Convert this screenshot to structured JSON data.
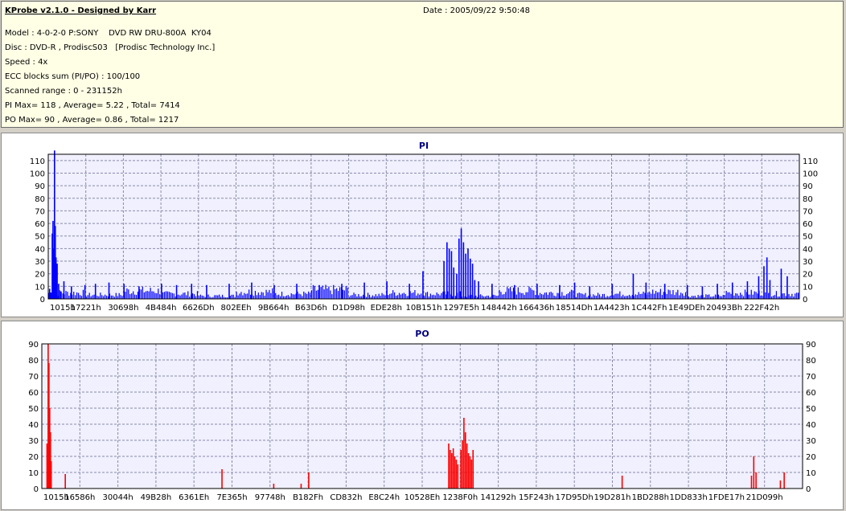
{
  "header": {
    "title": "KProbe v2.1.0 - Designed by Karr",
    "date": "Date : 2005/09/22 9:50:48",
    "model": "Model : 4-0-2-0 P:SONY    DVD RW DRU-800A  KY04",
    "disc": "Disc : DVD-R , ProdiscS03   [Prodisc Technology Inc.]",
    "speed": "Speed : 4x",
    "ecc": "ECC blocks sum (PI/PO) : 100/100",
    "range": "Scanned range : 0 - 231152h",
    "pi_stats": "PI Max= 118 , Average= 5.22 , Total= 7414",
    "po_stats": "PO Max= 90 , Average= 0.86 , Total= 1217"
  },
  "colors": {
    "background": "#d4d0c8",
    "header_bg": "#ffffe6",
    "plot_bg": "#f0f0ff",
    "pi_bar": "#0000ff",
    "po_bar": "#ff0000",
    "grid": "#8a8aa8",
    "title": "#000080"
  },
  "chart_data": [
    {
      "type": "bar",
      "title": "PI",
      "ylim": [
        0,
        115
      ],
      "yticks": [
        0,
        10,
        20,
        30,
        40,
        50,
        60,
        70,
        80,
        90,
        100,
        110
      ],
      "x_range": [
        "0h",
        "231152h"
      ],
      "x_ticklabels": [
        "1015h",
        "17221h",
        "30698h",
        "4B484h",
        "6626Dh",
        "802EEh",
        "9B664h",
        "B63D6h",
        "D1D98h",
        "EDE28h",
        "10B151h",
        "1297E5h",
        "148442h",
        "166436h",
        "18514Dh",
        "1A4423h",
        "1C442Fh",
        "1E49DEh",
        "20493Bh",
        "222F42h"
      ],
      "grid": true,
      "series": [
        {
          "baseline": [
            6,
            4,
            8,
            5,
            3,
            7,
            5,
            9,
            4,
            6,
            5,
            3,
            8,
            6,
            4,
            5,
            7,
            3,
            6,
            5
          ],
          "peaks": [
            [
              0.1,
              8
            ],
            [
              0.3,
              5
            ],
            [
              0.45,
              52
            ],
            [
              0.55,
              62
            ],
            [
              0.65,
              40
            ],
            [
              0.75,
              118
            ],
            [
              0.85,
              58
            ],
            [
              0.95,
              33
            ],
            [
              1.1,
              28
            ],
            [
              1.3,
              12
            ],
            [
              1.6,
              6
            ],
            [
              2.0,
              14
            ],
            [
              3.0,
              10
            ],
            [
              4.8,
              11
            ],
            [
              6.2,
              12
            ],
            [
              8.0,
              13
            ],
            [
              10.0,
              12
            ],
            [
              12.0,
              10
            ],
            [
              15.0,
              12
            ],
            [
              17.0,
              11
            ],
            [
              19.0,
              12
            ],
            [
              21.0,
              11
            ],
            [
              24.0,
              12
            ],
            [
              27.0,
              13
            ],
            [
              30.0,
              11
            ],
            [
              33.0,
              12
            ],
            [
              36.0,
              11
            ],
            [
              39.0,
              12
            ],
            [
              42.0,
              13
            ],
            [
              45.0,
              14
            ],
            [
              48.0,
              12
            ],
            [
              49.8,
              22
            ],
            [
              52.6,
              30
            ],
            [
              53.0,
              45
            ],
            [
              53.3,
              40
            ],
            [
              53.6,
              38
            ],
            [
              53.9,
              25
            ],
            [
              54.3,
              20
            ],
            [
              54.6,
              48
            ],
            [
              54.9,
              56
            ],
            [
              55.2,
              45
            ],
            [
              55.5,
              36
            ],
            [
              55.8,
              40
            ],
            [
              56.1,
              32
            ],
            [
              56.4,
              28
            ],
            [
              56.7,
              15
            ],
            [
              57.2,
              14
            ],
            [
              59.0,
              12
            ],
            [
              62.0,
              11
            ],
            [
              65.0,
              12
            ],
            [
              68.0,
              11
            ],
            [
              70.0,
              13
            ],
            [
              72.0,
              10
            ],
            [
              75.0,
              12
            ],
            [
              77.8,
              20
            ],
            [
              79.5,
              13
            ],
            [
              82.0,
              12
            ],
            [
              85.0,
              11
            ],
            [
              87.0,
              10
            ],
            [
              89.0,
              12
            ],
            [
              91.0,
              13
            ],
            [
              93.0,
              14
            ],
            [
              94.5,
              18
            ],
            [
              95.2,
              26
            ],
            [
              95.6,
              33
            ],
            [
              96.0,
              15
            ],
            [
              97.5,
              24
            ],
            [
              98.3,
              18
            ]
          ]
        }
      ]
    },
    {
      "type": "bar",
      "title": "PO",
      "ylim": [
        0,
        90
      ],
      "yticks": [
        0,
        10,
        20,
        30,
        40,
        50,
        60,
        70,
        80,
        90
      ],
      "x_range": [
        "0h",
        "231152h"
      ],
      "x_ticklabels": [
        "1015h",
        "16586h",
        "30044h",
        "49B28h",
        "6361Eh",
        "7E365h",
        "97748h",
        "B182Fh",
        "CD832h",
        "E8C24h",
        "10528Eh",
        "1238F0h",
        "141292h",
        "15F243h",
        "17D95Dh",
        "19D281h",
        "1BD288h",
        "1DD833h",
        "1FDE17h",
        "21D099h"
      ],
      "grid": true,
      "series": [
        {
          "baseline": [],
          "peaks": [
            [
              0.6,
              28
            ],
            [
              0.75,
              90
            ],
            [
              0.85,
              78
            ],
            [
              0.95,
              50
            ],
            [
              1.05,
              35
            ],
            [
              1.15,
              17
            ],
            [
              3.0,
              9
            ],
            [
              23.6,
              12
            ],
            [
              30.4,
              3
            ],
            [
              34.0,
              3
            ],
            [
              35.0,
              10
            ],
            [
              53.4,
              28
            ],
            [
              53.6,
              24
            ],
            [
              53.8,
              22
            ],
            [
              54.0,
              25
            ],
            [
              54.2,
              20
            ],
            [
              54.4,
              18
            ],
            [
              54.6,
              15
            ],
            [
              55.0,
              24
            ],
            [
              55.2,
              30
            ],
            [
              55.4,
              44
            ],
            [
              55.6,
              35
            ],
            [
              55.8,
              28
            ],
            [
              56.0,
              22
            ],
            [
              56.2,
              20
            ],
            [
              56.4,
              18
            ],
            [
              56.6,
              24
            ],
            [
              76.2,
              8
            ],
            [
              93.2,
              8
            ],
            [
              93.5,
              20
            ],
            [
              93.8,
              10
            ],
            [
              97.0,
              5
            ],
            [
              97.5,
              10
            ]
          ]
        }
      ]
    }
  ]
}
